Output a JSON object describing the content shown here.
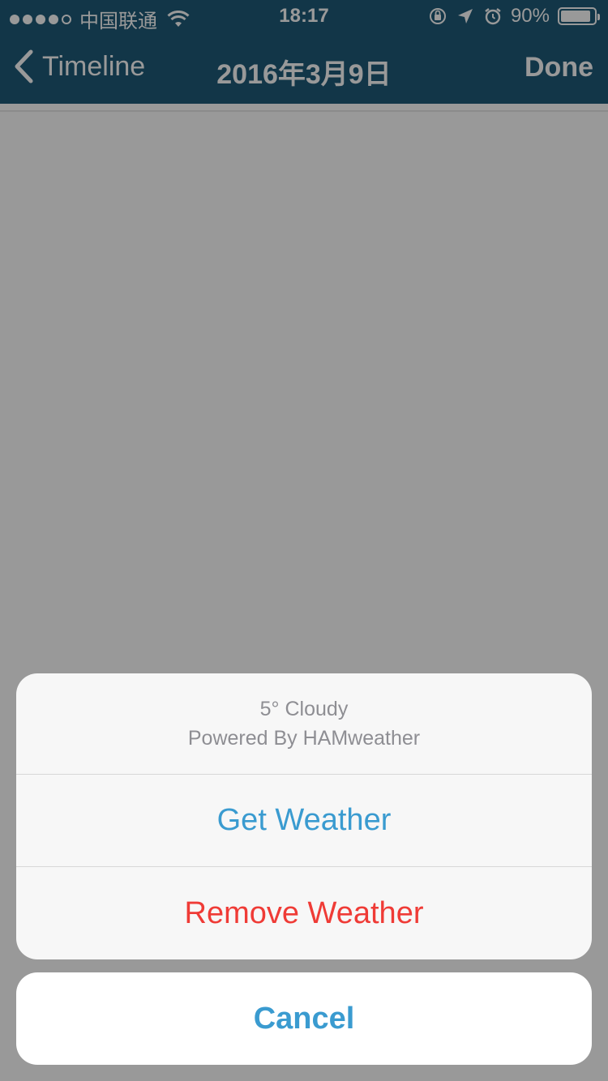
{
  "status_bar": {
    "carrier": "中国联通",
    "time": "18:17",
    "battery": "90%",
    "battery_level": 0.9,
    "icons": [
      "signal-dots",
      "wifi-icon",
      "orientation-lock-icon",
      "location-arrow-icon",
      "alarm-icon",
      "battery-icon"
    ]
  },
  "nav": {
    "back_label": "Timeline",
    "title": "2016年3月9日",
    "done_label": "Done"
  },
  "action_sheet": {
    "header_line1": "5° Cloudy",
    "header_line2": "Powered By HAMweather",
    "get_weather": "Get Weather",
    "remove_weather": "Remove Weather",
    "cancel": "Cancel"
  },
  "colors": {
    "nav_bar": "#1f5b79",
    "action_blue": "#3a9bd0",
    "destructive_red": "#ef3b36"
  }
}
